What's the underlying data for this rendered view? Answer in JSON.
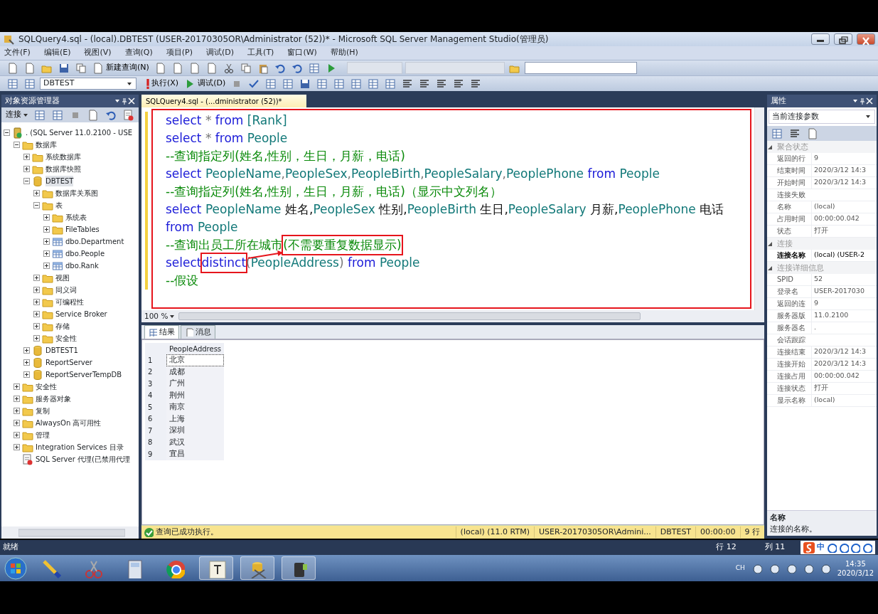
{
  "window": {
    "title": "SQLQuery4.sql - (local).DBTEST (USER-20170305OR\\Administrator (52))* - Microsoft SQL Server Management Studio(管理员)"
  },
  "menu": [
    "文件(F)",
    "编辑(E)",
    "视图(V)",
    "查询(Q)",
    "项目(P)",
    "调试(D)",
    "工具(T)",
    "窗口(W)",
    "帮助(H)"
  ],
  "toolbar": {
    "new_query": "新建查询(N)",
    "database": "DBTEST",
    "execute": "执行(X)",
    "debug": "调试(D)"
  },
  "object_explorer": {
    "title": "对象资源管理器",
    "connect": "连接",
    "tree": [
      {
        "label": ". (SQL Server 11.0.2100 - USE",
        "kind": "server",
        "expanded": true,
        "children": [
          {
            "label": "数据库",
            "kind": "folder",
            "expanded": true,
            "children": [
              {
                "label": "系统数据库",
                "kind": "folder",
                "expanded": false
              },
              {
                "label": "数据库快照",
                "kind": "folder",
                "expanded": false
              },
              {
                "label": "DBTEST",
                "kind": "database",
                "expanded": true,
                "selected": true,
                "children": [
                  {
                    "label": "数据库关系图",
                    "kind": "folder",
                    "expanded": false
                  },
                  {
                    "label": "表",
                    "kind": "folder",
                    "expanded": true,
                    "children": [
                      {
                        "label": "系统表",
                        "kind": "folder",
                        "expanded": false
                      },
                      {
                        "label": "FileTables",
                        "kind": "folder",
                        "expanded": false
                      },
                      {
                        "label": "dbo.Department",
                        "kind": "table",
                        "expanded": false
                      },
                      {
                        "label": "dbo.People",
                        "kind": "table",
                        "expanded": false
                      },
                      {
                        "label": "dbo.Rank",
                        "kind": "table",
                        "expanded": false
                      }
                    ]
                  },
                  {
                    "label": "视图",
                    "kind": "folder",
                    "expanded": false
                  },
                  {
                    "label": "同义词",
                    "kind": "folder",
                    "expanded": false
                  },
                  {
                    "label": "可编程性",
                    "kind": "folder",
                    "expanded": false
                  },
                  {
                    "label": "Service Broker",
                    "kind": "folder",
                    "expanded": false
                  },
                  {
                    "label": "存储",
                    "kind": "folder",
                    "expanded": false
                  },
                  {
                    "label": "安全性",
                    "kind": "folder",
                    "expanded": false
                  }
                ]
              },
              {
                "label": "DBTEST1",
                "kind": "database",
                "expanded": false,
                "selected": false
              },
              {
                "label": "ReportServer",
                "kind": "database",
                "expanded": false,
                "selected": false
              },
              {
                "label": "ReportServerTempDB",
                "kind": "database",
                "expanded": false,
                "selected": false
              }
            ]
          },
          {
            "label": "安全性",
            "kind": "folder",
            "expanded": false
          },
          {
            "label": "服务器对象",
            "kind": "folder",
            "expanded": false
          },
          {
            "label": "复制",
            "kind": "folder",
            "expanded": false
          },
          {
            "label": "AlwaysOn 高可用性",
            "kind": "folder",
            "expanded": false
          },
          {
            "label": "管理",
            "kind": "folder",
            "expanded": false
          },
          {
            "label": "Integration Services 目录",
            "kind": "folder",
            "expanded": false
          },
          {
            "label": "SQL Server 代理(已禁用代理",
            "kind": "agent"
          }
        ]
      }
    ]
  },
  "editor": {
    "tab": "SQLQuery4.sql - (...dministrator (52))*",
    "annotated": true,
    "callout_arrow": true,
    "lines": [
      [
        {
          "kind": "keyword",
          "text": "select"
        },
        {
          "kind": "op",
          "text": " * "
        },
        {
          "kind": "keyword",
          "text": "from"
        },
        {
          "kind": "ident",
          "text": " [Rank]"
        }
      ],
      [
        {
          "kind": "keyword",
          "text": "select"
        },
        {
          "kind": "op",
          "text": " * "
        },
        {
          "kind": "keyword",
          "text": "from"
        },
        {
          "kind": "ident",
          "text": " People"
        }
      ],
      [
        {
          "kind": "comment",
          "text": "--查询指定列(姓名,性别，生日，月薪，电话)"
        }
      ],
      [
        {
          "kind": "keyword",
          "text": "select"
        },
        {
          "kind": "ident",
          "text": " PeopleName"
        },
        {
          "kind": "op",
          "text": ","
        },
        {
          "kind": "ident",
          "text": "PeopleSex"
        },
        {
          "kind": "op",
          "text": ","
        },
        {
          "kind": "ident",
          "text": "PeopleBirth"
        },
        {
          "kind": "op",
          "text": ","
        },
        {
          "kind": "ident",
          "text": "PeopleSalary"
        },
        {
          "kind": "op",
          "text": ","
        },
        {
          "kind": "ident",
          "text": "PeoplePhone"
        },
        {
          "kind": "keyword",
          "text": " from"
        },
        {
          "kind": "ident",
          "text": " People"
        }
      ],
      [
        {
          "kind": "comment",
          "text": "--查询指定列(姓名,性别，生日，月薪，电话)（显示中文列名）"
        }
      ],
      [
        {
          "kind": "keyword",
          "text": "select"
        },
        {
          "kind": "ident",
          "text": " PeopleName"
        },
        {
          "kind": "plain",
          "text": " 姓名,"
        },
        {
          "kind": "ident",
          "text": "PeopleSex"
        },
        {
          "kind": "plain",
          "text": " 性别,"
        },
        {
          "kind": "ident",
          "text": "PeopleBirth"
        },
        {
          "kind": "plain",
          "text": " 生日,"
        },
        {
          "kind": "ident",
          "text": "PeopleSalary"
        },
        {
          "kind": "plain",
          "text": " 月薪,"
        },
        {
          "kind": "ident",
          "text": "PeoplePhone"
        },
        {
          "kind": "plain",
          "text": " 电话"
        }
      ],
      [
        {
          "kind": "keyword",
          "text": "from"
        },
        {
          "kind": "ident",
          "text": " People"
        }
      ],
      [
        {
          "kind": "comment",
          "text": "--查询出员工所在城市"
        },
        {
          "kind": "comment",
          "text": "(不需要重复数据显示)",
          "highlighted": true
        }
      ],
      [
        {
          "kind": "keyword",
          "text": "select"
        },
        {
          "kind": "keyword",
          "text": "distinct",
          "highlighted": true
        },
        {
          "kind": "op",
          "text": "("
        },
        {
          "kind": "ident",
          "text": "PeopleAddress"
        },
        {
          "kind": "op",
          "text": ")"
        },
        {
          "kind": "keyword",
          "text": " from"
        },
        {
          "kind": "ident",
          "text": " People"
        }
      ],
      [
        {
          "kind": "comment",
          "text": "--假设"
        }
      ]
    ],
    "zoom": "100 %"
  },
  "results": {
    "tabs": [
      {
        "label": "结果",
        "selected": true
      },
      {
        "label": "消息",
        "selected": false
      }
    ],
    "columns": [
      "PeopleAddress"
    ],
    "rows": [
      {
        "num": "1",
        "cells": [
          "北京"
        ],
        "selected": true
      },
      {
        "num": "2",
        "cells": [
          "成都"
        ],
        "selected": false
      },
      {
        "num": "3",
        "cells": [
          "广州"
        ],
        "selected": false
      },
      {
        "num": "4",
        "cells": [
          "荆州"
        ],
        "selected": false
      },
      {
        "num": "5",
        "cells": [
          "南京"
        ],
        "selected": false
      },
      {
        "num": "6",
        "cells": [
          "上海"
        ],
        "selected": false
      },
      {
        "num": "7",
        "cells": [
          "深圳"
        ],
        "selected": false
      },
      {
        "num": "8",
        "cells": [
          "武汉"
        ],
        "selected": false
      },
      {
        "num": "9",
        "cells": [
          "宜昌"
        ],
        "selected": false
      }
    ]
  },
  "query_status": {
    "message": "查询已成功执行。",
    "fields": [
      "(local) (11.0 RTM)",
      "USER-20170305OR\\Admini...",
      "DBTEST",
      "00:00:00",
      "9 行"
    ]
  },
  "properties": {
    "title": "属性",
    "object": "当前连接参数",
    "groups": [
      {
        "name": "聚合状态",
        "rows": [
          {
            "name": "返回的行",
            "value": "9"
          },
          {
            "name": "结束时间",
            "value": "2020/3/12 14:3"
          },
          {
            "name": "开始时间",
            "value": "2020/3/12 14:3"
          },
          {
            "name": "连接失败"
          },
          {
            "name": "名称",
            "value": "(local)"
          },
          {
            "name": "占用时间",
            "value": "00:00:00.042"
          },
          {
            "name": "状态",
            "value": "打开"
          }
        ]
      },
      {
        "name": "连接",
        "rows": [
          {
            "name": "连接名称",
            "value": "(local) (USER-2",
            "bold": true
          }
        ]
      },
      {
        "name": "连接详细信息",
        "rows": [
          {
            "name": "SPID",
            "value": "52"
          },
          {
            "name": "登录名",
            "value": "USER-2017030"
          },
          {
            "name": "返回的连",
            "value": "9"
          },
          {
            "name": "服务器版",
            "value": "11.0.2100"
          },
          {
            "name": "服务器名",
            "value": "."
          },
          {
            "name": "会话跟踪"
          },
          {
            "name": "连接结束",
            "value": "2020/3/12 14:3"
          },
          {
            "name": "连接开始",
            "value": "2020/3/12 14:3"
          },
          {
            "name": "连接占用",
            "value": "00:00:00.042"
          },
          {
            "name": "连接状态",
            "value": "打开"
          },
          {
            "name": "显示名称",
            "value": "(local)"
          }
        ]
      }
    ],
    "description": {
      "title": "名称",
      "text": "连接的名称。"
    }
  },
  "status_bar": {
    "text": "就绪",
    "line": "行 12",
    "column": "列 11",
    "ime": "中"
  },
  "taskbar": {
    "language": "CH",
    "time": "14:35",
    "date": "2020/3/12"
  }
}
